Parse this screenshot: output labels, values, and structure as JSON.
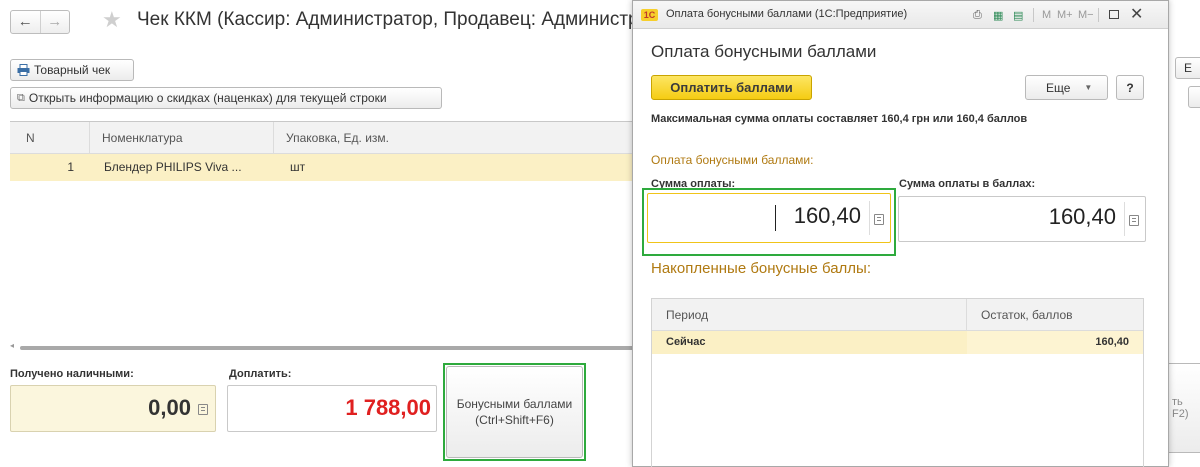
{
  "main": {
    "title": "Чек ККМ (Кассир: Администратор, Продавец: Администратор)",
    "toolbar": {
      "receipt_button": "Товарный чек",
      "discount_info_button": "Открыть информацию о скидках (наценках) для текущей строки"
    },
    "grid": {
      "columns": [
        "N",
        "Номенклатура",
        "Упаковка, Ед. изм."
      ],
      "rows": [
        {
          "n": "1",
          "item": "Блендер PHILIPS Viva ...",
          "unit": "шт"
        }
      ]
    },
    "received_cash_label": "Получено наличными:",
    "received_cash_value": "0,00",
    "to_pay_label": "Доплатить:",
    "to_pay_value": "1 788,00",
    "bonus_button_line1": "Бонусными баллами",
    "bonus_button_line2": "(Ctrl+Shift+F6)",
    "right_cut_text_1": "Е",
    "right_cut_text_2": "ть",
    "right_cut_text_3": "F2)"
  },
  "dialog": {
    "window_title": "Оплата бонусными баллами (1С:Предприятие)",
    "logo_text": "1С",
    "toolbar_icons": {
      "m": "M",
      "m_plus": "M+",
      "m_minus": "M−"
    },
    "heading": "Оплата бонусными баллами",
    "pay_button": "Оплатить баллами",
    "more_button": "Еще",
    "help_button": "?",
    "max_info": "Максимальная сумма оплаты составляет 160,4 грн или 160,4 баллов",
    "section_payment": "Оплата бонусными баллами:",
    "sum_label": "Сумма оплаты:",
    "sum_value": "160,40",
    "points_label": "Сумма оплаты в баллах:",
    "points_value": "160,40",
    "section_accumulated": "Накопленные бонусные баллы:",
    "table": {
      "columns": [
        "Период",
        "Остаток, баллов"
      ],
      "rows": [
        {
          "period": "Сейчас",
          "balance": "160,40"
        }
      ]
    }
  },
  "colors": {
    "accent_yellow": "#f5cc13",
    "highlight_green": "#2eaa3d",
    "to_pay_red": "#e02020",
    "section_orange": "#b07a12",
    "selected_row": "#fbf0c5"
  }
}
